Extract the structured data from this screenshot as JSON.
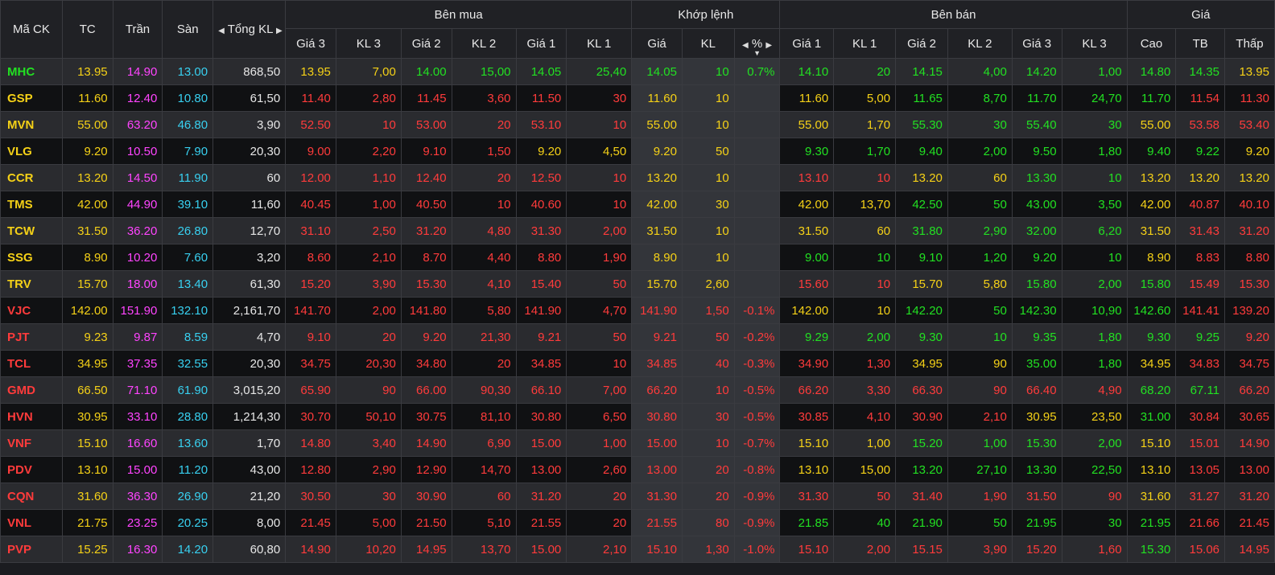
{
  "colors": {
    "up": "#22e022",
    "down": "#ff3b3b",
    "ref": "#f5d117",
    "ceil": "#ff44ff",
    "floor": "#38d0f0",
    "neutral": "#e6e6e6"
  },
  "header": {
    "symbol": "Mã CK",
    "ref": "TC",
    "ceil": "Trần",
    "floor": "Sàn",
    "total_vol": "Tổng KL",
    "buy_group": "Bên mua",
    "match_group": "Khớp lệnh",
    "sell_group": "Bên bán",
    "price_group": "Giá",
    "p3": "Giá 3",
    "v3": "KL 3",
    "p2": "Giá 2",
    "v2": "KL 2",
    "p1": "Giá 1",
    "v1": "KL 1",
    "match_price": "Giá",
    "match_vol": "KL",
    "match_pct": "%",
    "high": "Cao",
    "avg": "TB",
    "low": "Thấp"
  },
  "rows": [
    {
      "sym": "MHC",
      "tc": "13.95",
      "tran": "14.90",
      "san": "13.00",
      "tkl": "868,50",
      "b3": "13.95",
      "bv3": "7,00",
      "b2": "14.00",
      "bv2": "15,00",
      "b1": "14.05",
      "bv1": "25,40",
      "mp": "14.05",
      "mv": "10",
      "pct": "0.7%",
      "s1": "14.10",
      "sv1": "20",
      "s2": "14.15",
      "sv2": "4,00",
      "s3": "14.20",
      "sv3": "1,00",
      "hi": "14.80",
      "avg": "14.35",
      "lo": "13.95"
    },
    {
      "sym": "GSP",
      "tc": "11.60",
      "tran": "12.40",
      "san": "10.80",
      "tkl": "61,50",
      "b3": "11.40",
      "bv3": "2,80",
      "b2": "11.45",
      "bv2": "3,60",
      "b1": "11.50",
      "bv1": "30",
      "mp": "11.60",
      "mv": "10",
      "pct": "",
      "s1": "11.60",
      "sv1": "5,00",
      "s2": "11.65",
      "sv2": "8,70",
      "s3": "11.70",
      "sv3": "24,70",
      "hi": "11.70",
      "avg": "11.54",
      "lo": "11.30"
    },
    {
      "sym": "MVN",
      "tc": "55.00",
      "tran": "63.20",
      "san": "46.80",
      "tkl": "3,90",
      "b3": "52.50",
      "bv3": "10",
      "b2": "53.00",
      "bv2": "20",
      "b1": "53.10",
      "bv1": "10",
      "mp": "55.00",
      "mv": "10",
      "pct": "",
      "s1": "55.00",
      "sv1": "1,70",
      "s2": "55.30",
      "sv2": "30",
      "s3": "55.40",
      "sv3": "30",
      "hi": "55.00",
      "avg": "53.58",
      "lo": "53.40"
    },
    {
      "sym": "VLG",
      "tc": "9.20",
      "tran": "10.50",
      "san": "7.90",
      "tkl": "20,30",
      "b3": "9.00",
      "bv3": "2,20",
      "b2": "9.10",
      "bv2": "1,50",
      "b1": "9.20",
      "bv1": "4,50",
      "mp": "9.20",
      "mv": "50",
      "pct": "",
      "s1": "9.30",
      "sv1": "1,70",
      "s2": "9.40",
      "sv2": "2,00",
      "s3": "9.50",
      "sv3": "1,80",
      "hi": "9.40",
      "avg": "9.22",
      "lo": "9.20"
    },
    {
      "sym": "CCR",
      "tc": "13.20",
      "tran": "14.50",
      "san": "11.90",
      "tkl": "60",
      "b3": "12.00",
      "bv3": "1,10",
      "b2": "12.40",
      "bv2": "20",
      "b1": "12.50",
      "bv1": "10",
      "mp": "13.20",
      "mv": "10",
      "pct": "",
      "s1": "13.10",
      "sv1": "10",
      "s2": "13.20",
      "sv2": "60",
      "s3": "13.30",
      "sv3": "10",
      "hi": "13.20",
      "avg": "13.20",
      "lo": "13.20"
    },
    {
      "sym": "TMS",
      "tc": "42.00",
      "tran": "44.90",
      "san": "39.10",
      "tkl": "11,60",
      "b3": "40.45",
      "bv3": "1,00",
      "b2": "40.50",
      "bv2": "10",
      "b1": "40.60",
      "bv1": "10",
      "mp": "42.00",
      "mv": "30",
      "pct": "",
      "s1": "42.00",
      "sv1": "13,70",
      "s2": "42.50",
      "sv2": "50",
      "s3": "43.00",
      "sv3": "3,50",
      "hi": "42.00",
      "avg": "40.87",
      "lo": "40.10"
    },
    {
      "sym": "TCW",
      "tc": "31.50",
      "tran": "36.20",
      "san": "26.80",
      "tkl": "12,70",
      "b3": "31.10",
      "bv3": "2,50",
      "b2": "31.20",
      "bv2": "4,80",
      "b1": "31.30",
      "bv1": "2,00",
      "mp": "31.50",
      "mv": "10",
      "pct": "",
      "s1": "31.50",
      "sv1": "60",
      "s2": "31.80",
      "sv2": "2,90",
      "s3": "32.00",
      "sv3": "6,20",
      "hi": "31.50",
      "avg": "31.43",
      "lo": "31.20"
    },
    {
      "sym": "SSG",
      "tc": "8.90",
      "tran": "10.20",
      "san": "7.60",
      "tkl": "3,20",
      "b3": "8.60",
      "bv3": "2,10",
      "b2": "8.70",
      "bv2": "4,40",
      "b1": "8.80",
      "bv1": "1,90",
      "mp": "8.90",
      "mv": "10",
      "pct": "",
      "s1": "9.00",
      "sv1": "10",
      "s2": "9.10",
      "sv2": "1,20",
      "s3": "9.20",
      "sv3": "10",
      "hi": "8.90",
      "avg": "8.83",
      "lo": "8.80"
    },
    {
      "sym": "TRV",
      "tc": "15.70",
      "tran": "18.00",
      "san": "13.40",
      "tkl": "61,30",
      "b3": "15.20",
      "bv3": "3,90",
      "b2": "15.30",
      "bv2": "4,10",
      "b1": "15.40",
      "bv1": "50",
      "mp": "15.70",
      "mv": "2,60",
      "pct": "",
      "s1": "15.60",
      "sv1": "10",
      "s2": "15.70",
      "sv2": "5,80",
      "s3": "15.80",
      "sv3": "2,00",
      "hi": "15.80",
      "avg": "15.49",
      "lo": "15.30"
    },
    {
      "sym": "VJC",
      "tc": "142.00",
      "tran": "151.90",
      "san": "132.10",
      "tkl": "2,161,70",
      "b3": "141.70",
      "bv3": "2,00",
      "b2": "141.80",
      "bv2": "5,80",
      "b1": "141.90",
      "bv1": "4,70",
      "mp": "141.90",
      "mv": "1,50",
      "pct": "-0.1%",
      "s1": "142.00",
      "sv1": "10",
      "s2": "142.20",
      "sv2": "50",
      "s3": "142.30",
      "sv3": "10,90",
      "hi": "142.60",
      "avg": "141.41",
      "lo": "139.20"
    },
    {
      "sym": "PJT",
      "tc": "9.23",
      "tran": "9.87",
      "san": "8.59",
      "tkl": "4,70",
      "b3": "9.10",
      "bv3": "20",
      "b2": "9.20",
      "bv2": "21,30",
      "b1": "9.21",
      "bv1": "50",
      "mp": "9.21",
      "mv": "50",
      "pct": "-0.2%",
      "s1": "9.29",
      "sv1": "2,00",
      "s2": "9.30",
      "sv2": "10",
      "s3": "9.35",
      "sv3": "1,80",
      "hi": "9.30",
      "avg": "9.25",
      "lo": "9.20"
    },
    {
      "sym": "TCL",
      "tc": "34.95",
      "tran": "37.35",
      "san": "32.55",
      "tkl": "20,30",
      "b3": "34.75",
      "bv3": "20,30",
      "b2": "34.80",
      "bv2": "20",
      "b1": "34.85",
      "bv1": "10",
      "mp": "34.85",
      "mv": "40",
      "pct": "-0.3%",
      "s1": "34.90",
      "sv1": "1,30",
      "s2": "34.95",
      "sv2": "90",
      "s3": "35.00",
      "sv3": "1,80",
      "hi": "34.95",
      "avg": "34.83",
      "lo": "34.75"
    },
    {
      "sym": "GMD",
      "tc": "66.50",
      "tran": "71.10",
      "san": "61.90",
      "tkl": "3,015,20",
      "b3": "65.90",
      "bv3": "90",
      "b2": "66.00",
      "bv2": "90,30",
      "b1": "66.10",
      "bv1": "7,00",
      "mp": "66.20",
      "mv": "10",
      "pct": "-0.5%",
      "s1": "66.20",
      "sv1": "3,30",
      "s2": "66.30",
      "sv2": "90",
      "s3": "66.40",
      "sv3": "4,90",
      "hi": "68.20",
      "avg": "67.11",
      "lo": "66.20"
    },
    {
      "sym": "HVN",
      "tc": "30.95",
      "tran": "33.10",
      "san": "28.80",
      "tkl": "1,214,30",
      "b3": "30.70",
      "bv3": "50,10",
      "b2": "30.75",
      "bv2": "81,10",
      "b1": "30.80",
      "bv1": "6,50",
      "mp": "30.80",
      "mv": "30",
      "pct": "-0.5%",
      "s1": "30.85",
      "sv1": "4,10",
      "s2": "30.90",
      "sv2": "2,10",
      "s3": "30.95",
      "sv3": "23,50",
      "hi": "31.00",
      "avg": "30.84",
      "lo": "30.65"
    },
    {
      "sym": "VNF",
      "tc": "15.10",
      "tran": "16.60",
      "san": "13.60",
      "tkl": "1,70",
      "b3": "14.80",
      "bv3": "3,40",
      "b2": "14.90",
      "bv2": "6,90",
      "b1": "15.00",
      "bv1": "1,00",
      "mp": "15.00",
      "mv": "10",
      "pct": "-0.7%",
      "s1": "15.10",
      "sv1": "1,00",
      "s2": "15.20",
      "sv2": "1,00",
      "s3": "15.30",
      "sv3": "2,00",
      "hi": "15.10",
      "avg": "15.01",
      "lo": "14.90"
    },
    {
      "sym": "PDV",
      "tc": "13.10",
      "tran": "15.00",
      "san": "11.20",
      "tkl": "43,00",
      "b3": "12.80",
      "bv3": "2,90",
      "b2": "12.90",
      "bv2": "14,70",
      "b1": "13.00",
      "bv1": "2,60",
      "mp": "13.00",
      "mv": "20",
      "pct": "-0.8%",
      "s1": "13.10",
      "sv1": "15,00",
      "s2": "13.20",
      "sv2": "27,10",
      "s3": "13.30",
      "sv3": "22,50",
      "hi": "13.10",
      "avg": "13.05",
      "lo": "13.00"
    },
    {
      "sym": "CQN",
      "tc": "31.60",
      "tran": "36.30",
      "san": "26.90",
      "tkl": "21,20",
      "b3": "30.50",
      "bv3": "30",
      "b2": "30.90",
      "bv2": "60",
      "b1": "31.20",
      "bv1": "20",
      "mp": "31.30",
      "mv": "20",
      "pct": "-0.9%",
      "s1": "31.30",
      "sv1": "50",
      "s2": "31.40",
      "sv2": "1,90",
      "s3": "31.50",
      "sv3": "90",
      "hi": "31.60",
      "avg": "31.27",
      "lo": "31.20"
    },
    {
      "sym": "VNL",
      "tc": "21.75",
      "tran": "23.25",
      "san": "20.25",
      "tkl": "8,00",
      "b3": "21.45",
      "bv3": "5,00",
      "b2": "21.50",
      "bv2": "5,10",
      "b1": "21.55",
      "bv1": "20",
      "mp": "21.55",
      "mv": "80",
      "pct": "-0.9%",
      "s1": "21.85",
      "sv1": "40",
      "s2": "21.90",
      "sv2": "50",
      "s3": "21.95",
      "sv3": "30",
      "hi": "21.95",
      "avg": "21.66",
      "lo": "21.45"
    },
    {
      "sym": "PVP",
      "tc": "15.25",
      "tran": "16.30",
      "san": "14.20",
      "tkl": "60,80",
      "b3": "14.90",
      "bv3": "10,20",
      "b2": "14.95",
      "bv2": "13,70",
      "b1": "15.00",
      "bv1": "2,10",
      "mp": "15.10",
      "mv": "1,30",
      "pct": "-1.0%",
      "s1": "15.10",
      "sv1": "2,00",
      "s2": "15.15",
      "sv2": "3,90",
      "s3": "15.20",
      "sv3": "1,60",
      "hi": "15.30",
      "avg": "15.06",
      "lo": "14.95"
    }
  ]
}
